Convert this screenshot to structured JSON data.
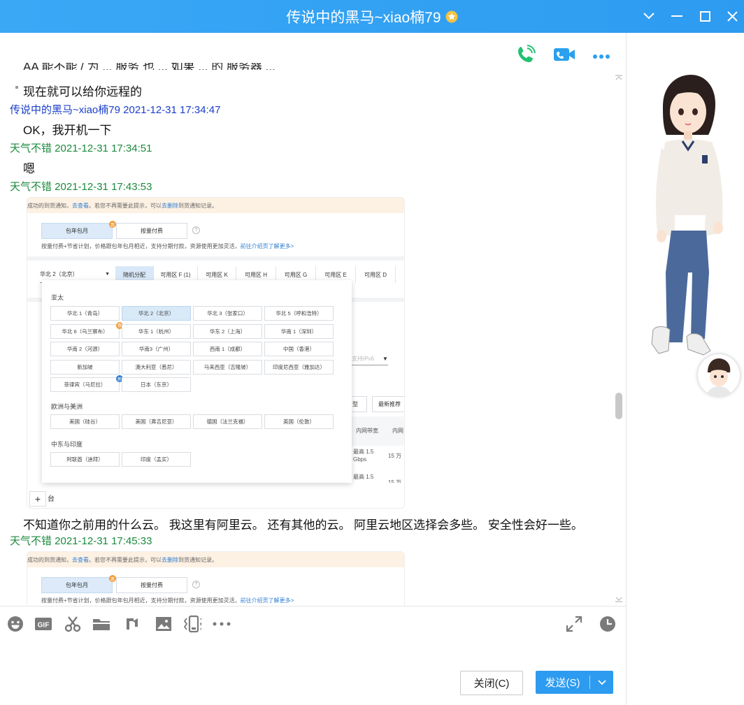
{
  "window": {
    "title": "传说中的黑马~xiao楠79",
    "badge_icon": "vip-star-icon"
  },
  "top_actions": {
    "voice_call": "phone-call-icon",
    "video_call": "video-call-icon",
    "more": "more-icon"
  },
  "messages": {
    "partial_top": "AA 能不能 / 为 ... 服务 也 ... 如果 ... 的 服务器 ...",
    "line1": "现在就可以给你远程的",
    "m2_meta": "传说中的黑马~xiao楠79 2021-12-31 17:34:47",
    "m2_text": "OK，我开机一下",
    "m3_meta": "天气不错 2021-12-31 17:34:51",
    "m3_text": "嗯",
    "m4_meta": "天气不错 2021-12-31 17:43:53",
    "m4_after": "不知道你之前用的什么云。 我这里有阿里云。 还有其他的云。 阿里云地区选择会多些。 安全性会好一些。",
    "m5_meta": "天气不错 2021-12-31 17:45:33"
  },
  "screenshot": {
    "banner_a": "成功的到货通知，",
    "banner_link1": "去查看",
    "banner_b": "。若您不再需要此提示，可以 ",
    "banner_link2": "去删除",
    "banner_c": " 到货通知记录。",
    "billing_monthly": "包年包月",
    "billing_usage": "按量付费",
    "billing_desc": "按量付费+节省计划，价格跟包年包月相近，支持分期付款，资源使用更加灵活，",
    "billing_link": "前往介绍页了解更多>",
    "region_select": "华北 2（北京）",
    "tabs": [
      "随机分配",
      "可用区 F (1)",
      "可用区 K",
      "可用区 H",
      "可用区 G",
      "可用区 E",
      "可用区 D"
    ],
    "groups": {
      "asia": "亚太",
      "euro": "欧洲与美洲",
      "mideast": "中东与印度"
    },
    "asia_regions": [
      "华北 1（青岛）",
      "华北 2（北京）",
      "华北 3（张家口）",
      "华北 5（呼和浩特）",
      "华北 6（乌兰察布）",
      "华东 1（杭州）",
      "华东 2（上海）",
      "华南 1（深圳）",
      "华南 2（河源）",
      "华南3（广州）",
      "西南 1（成都）",
      "中国（香港）",
      "新加坡",
      "澳大利亚（悉尼）",
      "马来西亚（吉隆坡）",
      "印度尼西亚（雅加达）",
      "菲律宾（马尼拉）",
      "日本（东京）"
    ],
    "euro_regions": [
      "美国（硅谷）",
      "美国（弗吉尼亚）",
      "德国（法兰克福）",
      "英国（伦敦）"
    ],
    "mideast_regions": [
      "阿联酋（迪拜）",
      "印度（孟买）"
    ],
    "side_ipv6": "支持IPv6",
    "side_type": "型",
    "side_recommend": "最新推荐",
    "side_bandwidth": "内网带宽",
    "side_inner": "内网",
    "side_bw1": "最高 1.5",
    "side_bw1b": "Gbps",
    "side_price": "15 万",
    "side_bw2": "最高 1.5",
    "side_price2": "15 万",
    "qty_unit": "台"
  },
  "toolbar": {
    "icons": [
      "emoji-icon",
      "gif-icon",
      "scissors-icon",
      "folder-icon",
      "music-icon",
      "image-icon",
      "shake-icon",
      "more-icon"
    ],
    "expand": "expand-icon",
    "history": "clock-icon"
  },
  "buttons": {
    "close": "关闭(C)",
    "send": "发送(S)"
  },
  "colors": {
    "titlebar": "#2d9bf0",
    "meta_blue": "#1a3ec9",
    "meta_green": "#1b8a3d",
    "send": "#2d9bf0"
  }
}
